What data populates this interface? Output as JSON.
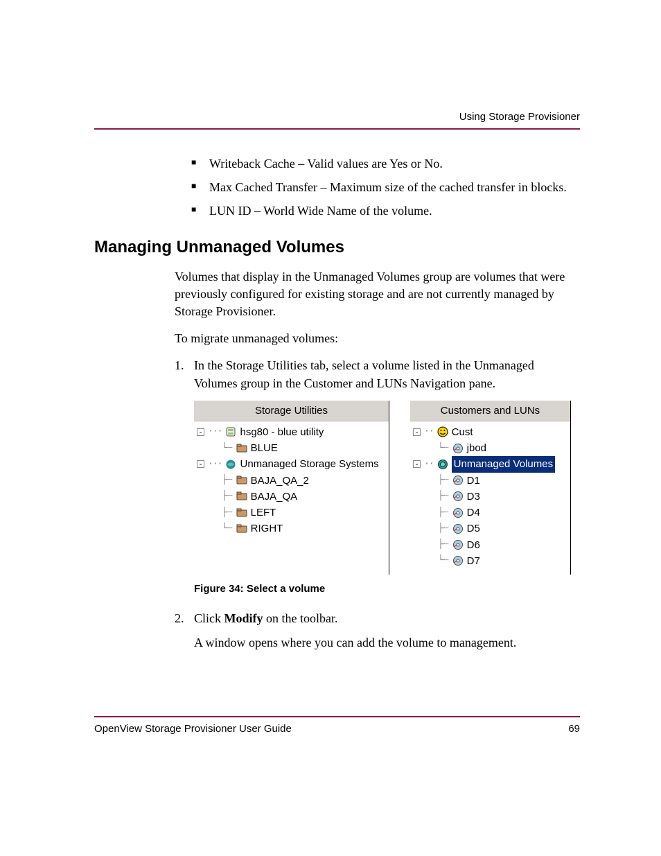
{
  "header": {
    "running": "Using Storage Provisioner"
  },
  "bullets": [
    "Writeback Cache – Valid values are Yes or No.",
    "Max Cached Transfer – Maximum size of the cached transfer in blocks.",
    "LUN ID – World Wide Name of the volume."
  ],
  "section": {
    "title": "Managing Unmanaged Volumes",
    "para1": "Volumes that display in the Unmanaged Volumes group are volumes that were previously configured for existing storage and are not currently managed by Storage Provisioner.",
    "para2": "To migrate unmanaged volumes:"
  },
  "steps": {
    "s1": "In the Storage Utilities tab, select a volume listed in the Unmanaged Volumes group in the Customer and LUNs Navigation pane.",
    "s2a": "Click ",
    "s2b": "Modify",
    "s2c": " on the toolbar.",
    "s2sub": "A window opens where you can add the volume to management."
  },
  "figure": {
    "caption": "Figure 34:  Select a volume",
    "left": {
      "header": "Storage Utilities",
      "n1": "hsg80 - blue utility",
      "n1a": "BLUE",
      "n2": "Unmanaged Storage Systems",
      "n2a": "BAJA_QA_2",
      "n2b": "BAJA_QA",
      "n2c": "LEFT",
      "n2d": "RIGHT"
    },
    "right": {
      "header": "Customers and LUNs",
      "n1": "Cust",
      "n1a": "jbod",
      "n2": "Unmanaged Volumes",
      "n2a": "D1",
      "n2b": "D3",
      "n2c": "D4",
      "n2d": "D5",
      "n2e": "D6",
      "n2f": "D7"
    }
  },
  "footer": {
    "title": "OpenView Storage Provisioner User Guide",
    "page": "69"
  }
}
